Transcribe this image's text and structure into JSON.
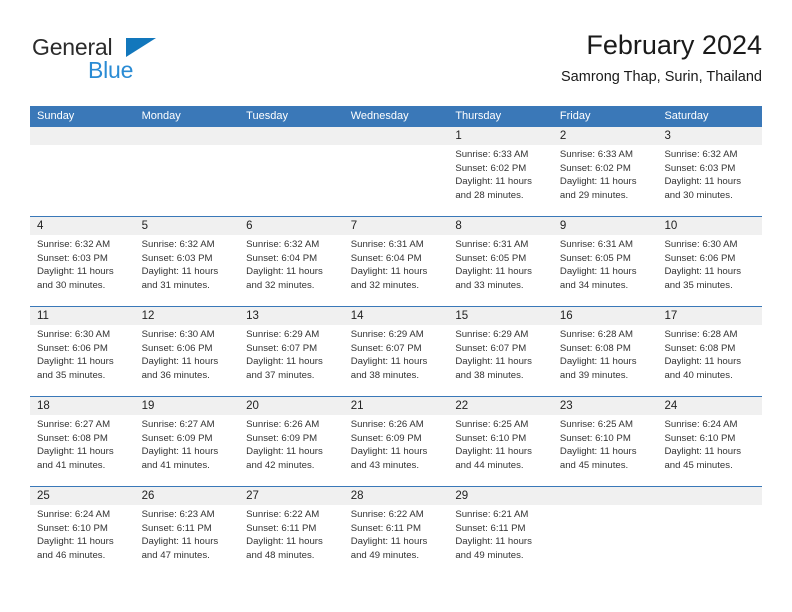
{
  "brand": {
    "line1": "General",
    "line2": "Blue",
    "triangle_icon": "triangle-logo-icon",
    "color_dark": "#2b2b2b",
    "color_blue": "#2a8bd4",
    "color_triangle": "#1277bc"
  },
  "header": {
    "title": "February 2024",
    "subtitle": "Samrong Thap, Surin, Thailand"
  },
  "theme": {
    "header_blue": "#3a78b8",
    "day_band_gray": "#f0f0f0",
    "text": "#222222"
  },
  "weekdays": [
    "Sunday",
    "Monday",
    "Tuesday",
    "Wednesday",
    "Thursday",
    "Friday",
    "Saturday"
  ],
  "weeks": [
    [
      {
        "day": "",
        "empty": true,
        "sunrise": "",
        "sunset": "",
        "daylight_line1": "",
        "daylight_line2": ""
      },
      {
        "day": "",
        "empty": true,
        "sunrise": "",
        "sunset": "",
        "daylight_line1": "",
        "daylight_line2": ""
      },
      {
        "day": "",
        "empty": true,
        "sunrise": "",
        "sunset": "",
        "daylight_line1": "",
        "daylight_line2": ""
      },
      {
        "day": "",
        "empty": true,
        "sunrise": "",
        "sunset": "",
        "daylight_line1": "",
        "daylight_line2": ""
      },
      {
        "day": "1",
        "empty": false,
        "sunrise": "Sunrise: 6:33 AM",
        "sunset": "Sunset: 6:02 PM",
        "daylight_line1": "Daylight: 11 hours",
        "daylight_line2": "and 28 minutes."
      },
      {
        "day": "2",
        "empty": false,
        "sunrise": "Sunrise: 6:33 AM",
        "sunset": "Sunset: 6:02 PM",
        "daylight_line1": "Daylight: 11 hours",
        "daylight_line2": "and 29 minutes."
      },
      {
        "day": "3",
        "empty": false,
        "sunrise": "Sunrise: 6:32 AM",
        "sunset": "Sunset: 6:03 PM",
        "daylight_line1": "Daylight: 11 hours",
        "daylight_line2": "and 30 minutes."
      }
    ],
    [
      {
        "day": "4",
        "empty": false,
        "sunrise": "Sunrise: 6:32 AM",
        "sunset": "Sunset: 6:03 PM",
        "daylight_line1": "Daylight: 11 hours",
        "daylight_line2": "and 30 minutes."
      },
      {
        "day": "5",
        "empty": false,
        "sunrise": "Sunrise: 6:32 AM",
        "sunset": "Sunset: 6:03 PM",
        "daylight_line1": "Daylight: 11 hours",
        "daylight_line2": "and 31 minutes."
      },
      {
        "day": "6",
        "empty": false,
        "sunrise": "Sunrise: 6:32 AM",
        "sunset": "Sunset: 6:04 PM",
        "daylight_line1": "Daylight: 11 hours",
        "daylight_line2": "and 32 minutes."
      },
      {
        "day": "7",
        "empty": false,
        "sunrise": "Sunrise: 6:31 AM",
        "sunset": "Sunset: 6:04 PM",
        "daylight_line1": "Daylight: 11 hours",
        "daylight_line2": "and 32 minutes."
      },
      {
        "day": "8",
        "empty": false,
        "sunrise": "Sunrise: 6:31 AM",
        "sunset": "Sunset: 6:05 PM",
        "daylight_line1": "Daylight: 11 hours",
        "daylight_line2": "and 33 minutes."
      },
      {
        "day": "9",
        "empty": false,
        "sunrise": "Sunrise: 6:31 AM",
        "sunset": "Sunset: 6:05 PM",
        "daylight_line1": "Daylight: 11 hours",
        "daylight_line2": "and 34 minutes."
      },
      {
        "day": "10",
        "empty": false,
        "sunrise": "Sunrise: 6:30 AM",
        "sunset": "Sunset: 6:06 PM",
        "daylight_line1": "Daylight: 11 hours",
        "daylight_line2": "and 35 minutes."
      }
    ],
    [
      {
        "day": "11",
        "empty": false,
        "sunrise": "Sunrise: 6:30 AM",
        "sunset": "Sunset: 6:06 PM",
        "daylight_line1": "Daylight: 11 hours",
        "daylight_line2": "and 35 minutes."
      },
      {
        "day": "12",
        "empty": false,
        "sunrise": "Sunrise: 6:30 AM",
        "sunset": "Sunset: 6:06 PM",
        "daylight_line1": "Daylight: 11 hours",
        "daylight_line2": "and 36 minutes."
      },
      {
        "day": "13",
        "empty": false,
        "sunrise": "Sunrise: 6:29 AM",
        "sunset": "Sunset: 6:07 PM",
        "daylight_line1": "Daylight: 11 hours",
        "daylight_line2": "and 37 minutes."
      },
      {
        "day": "14",
        "empty": false,
        "sunrise": "Sunrise: 6:29 AM",
        "sunset": "Sunset: 6:07 PM",
        "daylight_line1": "Daylight: 11 hours",
        "daylight_line2": "and 38 minutes."
      },
      {
        "day": "15",
        "empty": false,
        "sunrise": "Sunrise: 6:29 AM",
        "sunset": "Sunset: 6:07 PM",
        "daylight_line1": "Daylight: 11 hours",
        "daylight_line2": "and 38 minutes."
      },
      {
        "day": "16",
        "empty": false,
        "sunrise": "Sunrise: 6:28 AM",
        "sunset": "Sunset: 6:08 PM",
        "daylight_line1": "Daylight: 11 hours",
        "daylight_line2": "and 39 minutes."
      },
      {
        "day": "17",
        "empty": false,
        "sunrise": "Sunrise: 6:28 AM",
        "sunset": "Sunset: 6:08 PM",
        "daylight_line1": "Daylight: 11 hours",
        "daylight_line2": "and 40 minutes."
      }
    ],
    [
      {
        "day": "18",
        "empty": false,
        "sunrise": "Sunrise: 6:27 AM",
        "sunset": "Sunset: 6:08 PM",
        "daylight_line1": "Daylight: 11 hours",
        "daylight_line2": "and 41 minutes."
      },
      {
        "day": "19",
        "empty": false,
        "sunrise": "Sunrise: 6:27 AM",
        "sunset": "Sunset: 6:09 PM",
        "daylight_line1": "Daylight: 11 hours",
        "daylight_line2": "and 41 minutes."
      },
      {
        "day": "20",
        "empty": false,
        "sunrise": "Sunrise: 6:26 AM",
        "sunset": "Sunset: 6:09 PM",
        "daylight_line1": "Daylight: 11 hours",
        "daylight_line2": "and 42 minutes."
      },
      {
        "day": "21",
        "empty": false,
        "sunrise": "Sunrise: 6:26 AM",
        "sunset": "Sunset: 6:09 PM",
        "daylight_line1": "Daylight: 11 hours",
        "daylight_line2": "and 43 minutes."
      },
      {
        "day": "22",
        "empty": false,
        "sunrise": "Sunrise: 6:25 AM",
        "sunset": "Sunset: 6:10 PM",
        "daylight_line1": "Daylight: 11 hours",
        "daylight_line2": "and 44 minutes."
      },
      {
        "day": "23",
        "empty": false,
        "sunrise": "Sunrise: 6:25 AM",
        "sunset": "Sunset: 6:10 PM",
        "daylight_line1": "Daylight: 11 hours",
        "daylight_line2": "and 45 minutes."
      },
      {
        "day": "24",
        "empty": false,
        "sunrise": "Sunrise: 6:24 AM",
        "sunset": "Sunset: 6:10 PM",
        "daylight_line1": "Daylight: 11 hours",
        "daylight_line2": "and 45 minutes."
      }
    ],
    [
      {
        "day": "25",
        "empty": false,
        "sunrise": "Sunrise: 6:24 AM",
        "sunset": "Sunset: 6:10 PM",
        "daylight_line1": "Daylight: 11 hours",
        "daylight_line2": "and 46 minutes."
      },
      {
        "day": "26",
        "empty": false,
        "sunrise": "Sunrise: 6:23 AM",
        "sunset": "Sunset: 6:11 PM",
        "daylight_line1": "Daylight: 11 hours",
        "daylight_line2": "and 47 minutes."
      },
      {
        "day": "27",
        "empty": false,
        "sunrise": "Sunrise: 6:22 AM",
        "sunset": "Sunset: 6:11 PM",
        "daylight_line1": "Daylight: 11 hours",
        "daylight_line2": "and 48 minutes."
      },
      {
        "day": "28",
        "empty": false,
        "sunrise": "Sunrise: 6:22 AM",
        "sunset": "Sunset: 6:11 PM",
        "daylight_line1": "Daylight: 11 hours",
        "daylight_line2": "and 49 minutes."
      },
      {
        "day": "29",
        "empty": false,
        "sunrise": "Sunrise: 6:21 AM",
        "sunset": "Sunset: 6:11 PM",
        "daylight_line1": "Daylight: 11 hours",
        "daylight_line2": "and 49 minutes."
      },
      {
        "day": "",
        "empty": true,
        "sunrise": "",
        "sunset": "",
        "daylight_line1": "",
        "daylight_line2": ""
      },
      {
        "day": "",
        "empty": true,
        "sunrise": "",
        "sunset": "",
        "daylight_line1": "",
        "daylight_line2": ""
      }
    ]
  ]
}
